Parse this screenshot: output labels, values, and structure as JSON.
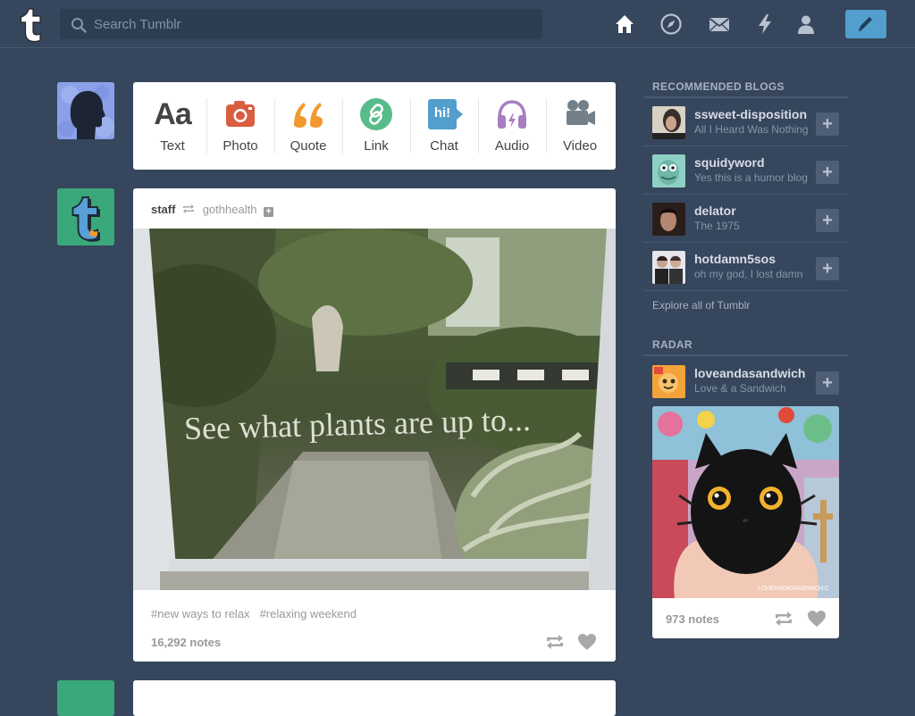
{
  "header": {
    "search_placeholder": "Search Tumblr",
    "nav": [
      "home-icon",
      "compass-icon",
      "mail-icon",
      "lightning-icon",
      "person-icon"
    ],
    "compose_icon": "pencil-icon",
    "accent": "#529ecc"
  },
  "post_types": [
    {
      "label": "Text",
      "icon": "text-icon",
      "glyph": "Aa",
      "color": "#444444"
    },
    {
      "label": "Photo",
      "icon": "camera-icon",
      "color": "#d95e40"
    },
    {
      "label": "Quote",
      "icon": "quote-icon",
      "color": "#f2992e"
    },
    {
      "label": "Link",
      "icon": "link-icon",
      "color": "#56bc8a"
    },
    {
      "label": "Chat",
      "icon": "chat-icon",
      "glyph": "hi!",
      "color": "#529ecc"
    },
    {
      "label": "Audio",
      "icon": "headphones-icon",
      "color": "#a77dc2"
    },
    {
      "label": "Video",
      "icon": "video-camera-icon",
      "color": "#748089"
    }
  ],
  "post": {
    "author": "staff",
    "reblogged_from": "gothhealth",
    "image_caption": "See what plants are up to...",
    "tags": [
      "#new ways to relax",
      "#relaxing weekend"
    ],
    "notes": "16,292 notes"
  },
  "sidebar": {
    "recommended_title": "RECOMMENDED BLOGS",
    "blogs": [
      {
        "name": "ssweet-disposition",
        "desc": "All I Heard Was Nothing"
      },
      {
        "name": "squidyword",
        "desc": "Yes this is a humor blog"
      },
      {
        "name": "delator",
        "desc": "The 1975"
      },
      {
        "name": "hotdamn5sos",
        "desc": "oh my god, I lost damn"
      }
    ],
    "explore": "Explore all of Tumblr",
    "radar_title": "RADAR",
    "radar": {
      "name": "loveandasandwich",
      "desc": "Love & a Sandwich",
      "watermark": "LOVEANDASANDWICH.C",
      "notes": "973 notes"
    }
  }
}
